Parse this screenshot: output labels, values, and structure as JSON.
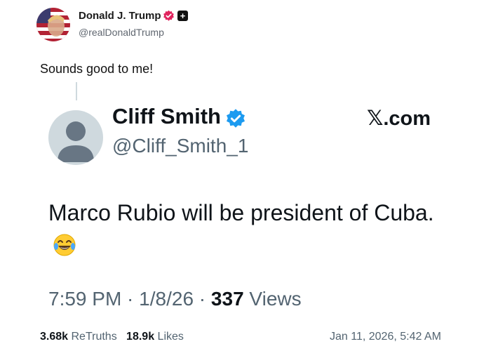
{
  "post": {
    "author_name": "Donald J. Trump",
    "author_handle": "@realDonaldTrump",
    "text": "Sounds good to me!"
  },
  "quoted": {
    "name": "Cliff Smith",
    "handle": "@Cliff_Smith_1",
    "source": "𝕏.com",
    "text": "Marco Rubio will be president of Cuba.",
    "time": "7:59 PM",
    "date": "1/8/26",
    "views_count": "337",
    "views_label": "Views"
  },
  "footer": {
    "retruths_count": "3.68k",
    "retruths_label": "ReTruths",
    "likes_count": "18.9k",
    "likes_label": "Likes",
    "timestamp": "Jan 11, 2026, 5:42 AM"
  },
  "colors": {
    "verified_blue": "#1d9bf0",
    "badge_pink": "#e0245e",
    "muted_text": "#536471"
  },
  "icons": {
    "verified": "verified-check-icon",
    "badge": "verified-badge-icon",
    "plus": "plus-badge-icon",
    "emoji": "tears-of-joy-emoji"
  }
}
